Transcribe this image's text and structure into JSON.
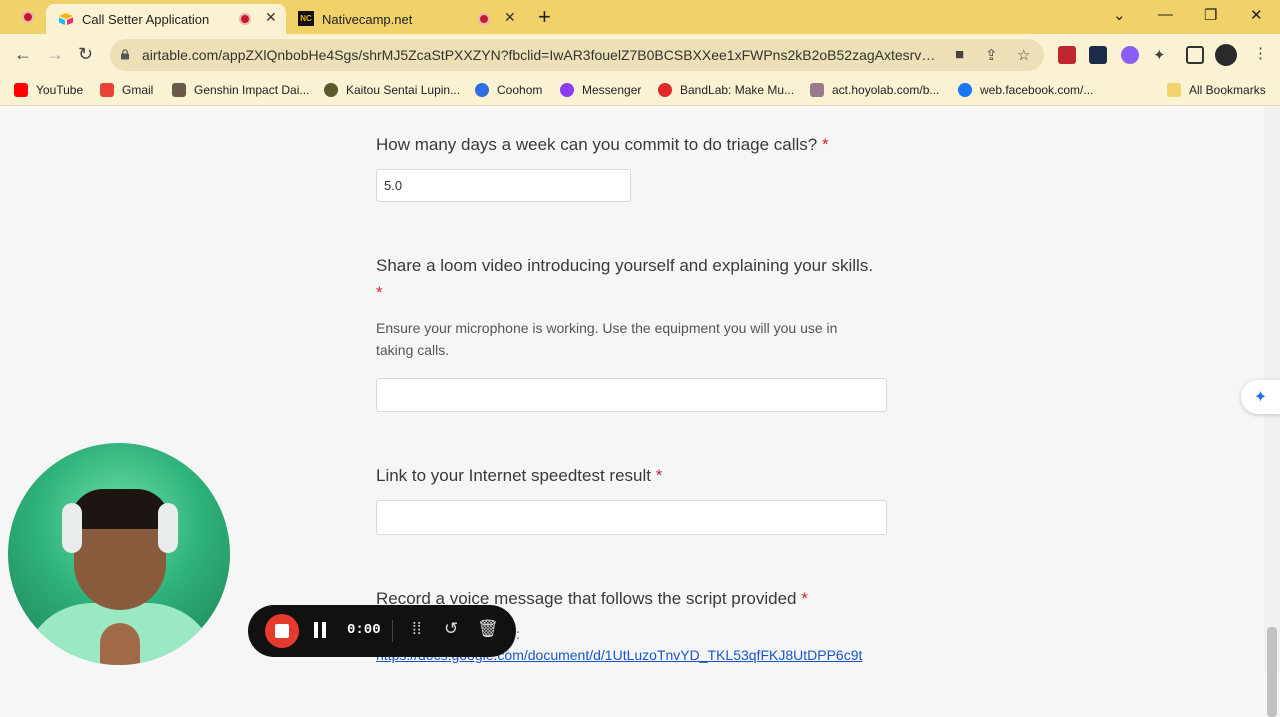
{
  "browser": {
    "tabs": [
      {
        "label": "Call Setter Application",
        "active": true
      },
      {
        "label": "Nativecamp.net",
        "active": false
      }
    ],
    "new_tab_icon": "plus-icon",
    "url": "airtable.com/appZXlQnbobHe4Sgs/shrMJ5ZcaStPXXZYN?fbclid=IwAR3fouelZ7B0BCSBXXee1xFWPns2kB2oB52zagAxtesrvZrslD-...",
    "bookmarks": [
      {
        "label": "YouTube",
        "color": "#ff0000"
      },
      {
        "label": "Gmail",
        "color": "#ea4335"
      },
      {
        "label": "Genshin Impact Dai...",
        "color": "#6b5a4a"
      },
      {
        "label": "Kaitou Sentai Lupin...",
        "color": "#5a5a2a"
      },
      {
        "label": "Coohom",
        "color": "#2f6ee0"
      },
      {
        "label": "Messenger",
        "color": "#8a3cf0"
      },
      {
        "label": "BandLab: Make Mu...",
        "color": "#e02a2a"
      },
      {
        "label": "act.hoyolab.com/b...",
        "color": "#9a7a8a"
      },
      {
        "label": "web.facebook.com/...",
        "color": "#1877f2"
      }
    ],
    "all_bookmarks": "All Bookmarks"
  },
  "form": {
    "q1": {
      "label": "How many days a week can you commit to do triage calls?",
      "required": "*",
      "value": "5.0"
    },
    "q2": {
      "label": "Share a loom video introducing yourself and explaining your skills.",
      "required": "*",
      "help": "Ensure your microphone is working. Use the equipment you will you use in taking calls.",
      "value": ""
    },
    "q3": {
      "label": "Link to your Internet speedtest result",
      "required": "*",
      "value": ""
    },
    "q4": {
      "label": "Record a voice message that follows the script provided",
      "required": "*",
      "help_fragment": ":",
      "link": "https://docs.google.com/document/d/1UtLuzoTnvYD_TKL53qfFKJ8UtDPP6c9t"
    }
  },
  "recorder": {
    "time": "0:00"
  },
  "colors": {
    "tabbar": "#f1d16a",
    "required": "#d0253d",
    "link": "#1a55c8",
    "record": "#e53a2e"
  }
}
